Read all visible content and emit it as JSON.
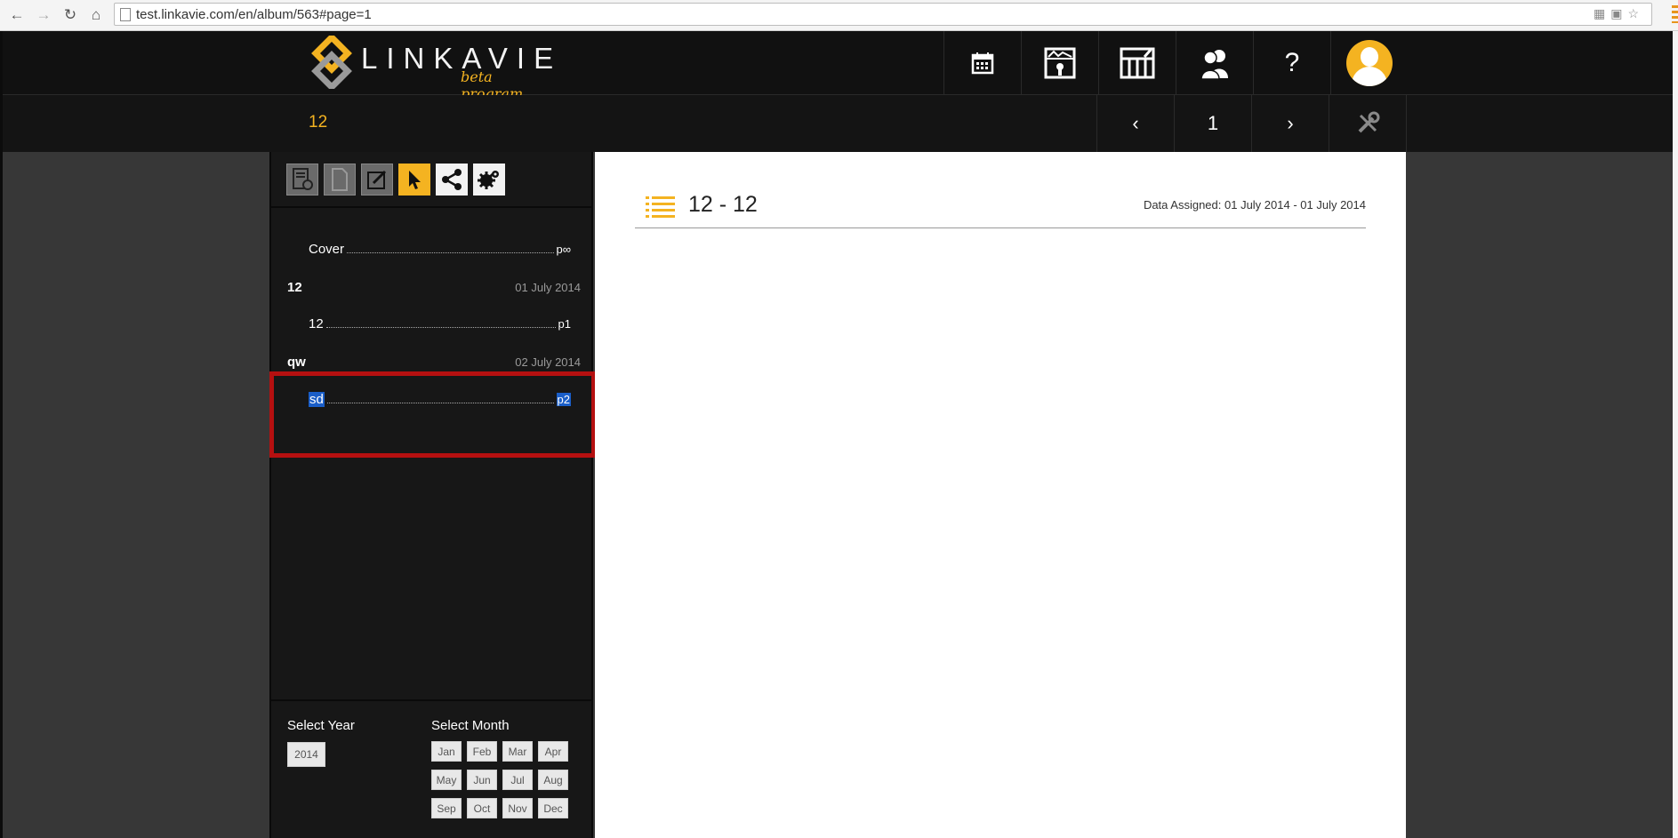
{
  "browser": {
    "url": "test.linkavie.com/en/album/563#page=1",
    "back_icon": "arrow-left-icon",
    "forward_icon": "arrow-right-icon",
    "reload_icon": "reload-icon",
    "home_icon": "home-icon"
  },
  "header": {
    "logo_text": "LINKAVIE",
    "logo_subtitle": "beta program",
    "nav_icons": [
      "calendar-icon",
      "photo-album-icon",
      "bookshelf-icon",
      "people-icon",
      "help-icon",
      "avatar"
    ],
    "help_label": "?"
  },
  "subheader": {
    "album_title": "12",
    "prev_label": "‹",
    "page_number": "1",
    "next_label": "›",
    "tools_icon": "wrench-icon"
  },
  "sidebar": {
    "tools": [
      "album-settings-icon",
      "page-icon",
      "edit-icon",
      "select-pointer-icon",
      "share-icon",
      "settings-icon"
    ],
    "active_tool": "select-pointer-icon",
    "toc": {
      "cover": {
        "label": "Cover",
        "page": "p∞"
      },
      "chapters": [
        {
          "name": "12",
          "date": "01 July 2014",
          "page": {
            "label": "12",
            "page": "p1"
          }
        },
        {
          "name": "qw",
          "date": "02 July 2014",
          "page": {
            "label": "sd",
            "page": "p2"
          }
        }
      ]
    },
    "filter": {
      "year_label": "Select Year",
      "month_label": "Select Month",
      "years": [
        "2014"
      ],
      "months": [
        "Jan",
        "Feb",
        "Mar",
        "Apr",
        "May",
        "Jun",
        "Jul",
        "Aug",
        "Sep",
        "Oct",
        "Nov",
        "Dec"
      ]
    }
  },
  "content": {
    "title": "12 - 12",
    "date_assigned": "Data Assigned: 01 July 2014 - 01 July 2014",
    "icon": "list-icon"
  },
  "colors": {
    "accent": "#f4b321",
    "highlight_border": "#b51010",
    "selection": "#1a5ec8"
  }
}
